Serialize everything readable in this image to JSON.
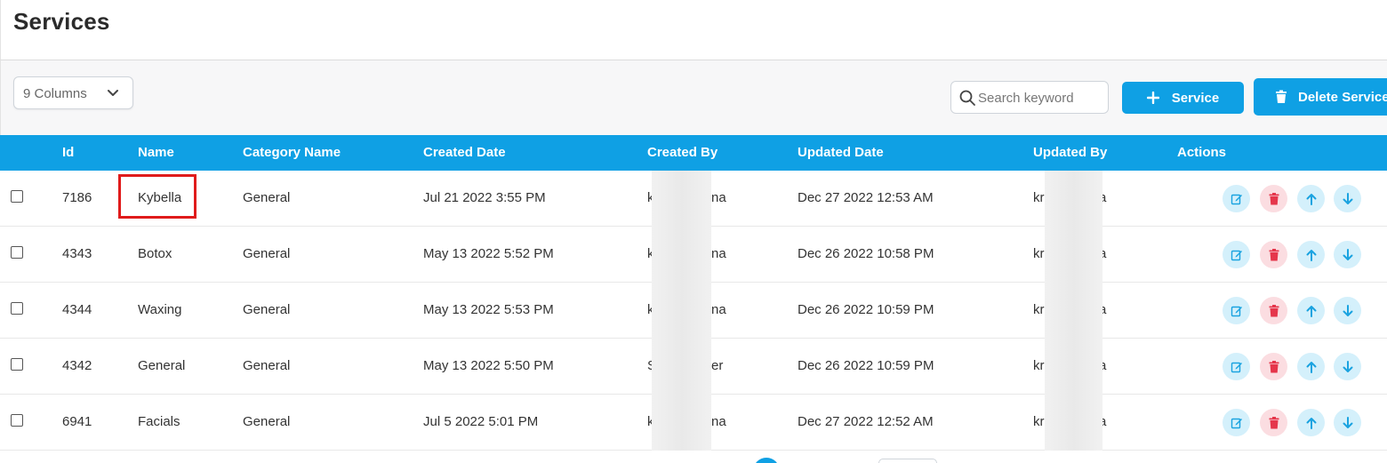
{
  "page": {
    "title": "Services"
  },
  "toolbar": {
    "columns_select": {
      "value": "9 Columns",
      "icon": "chevron-down-icon"
    },
    "search": {
      "placeholder": "Search keyword",
      "value": "",
      "icon": "search-icon"
    },
    "add_button": {
      "label": "Service",
      "icon": "plus-icon"
    },
    "delete_button": {
      "label": "Delete Service",
      "icon": "trash-icon"
    },
    "accent_color": "#0fa0e4"
  },
  "table": {
    "headers": [
      "Id",
      "Name",
      "Category Name",
      "Created Date",
      "Created By",
      "Updated Date",
      "Updated By",
      "Actions"
    ],
    "rows": [
      {
        "id": "7186",
        "name": "Kybella",
        "category": "General",
        "created_date": "Jul 21 2022 3:55 PM",
        "created_by_a": "k",
        "created_by_b": "na",
        "updated_date": "Dec 27 2022 12:53 AM",
        "updated_by_a": "kr",
        "updated_by_b": "a"
      },
      {
        "id": "4343",
        "name": "Botox",
        "category": "General",
        "created_date": "May 13 2022 5:52 PM",
        "created_by_a": "k",
        "created_by_b": "na",
        "updated_date": "Dec 26 2022 10:58 PM",
        "updated_by_a": "kr",
        "updated_by_b": "a"
      },
      {
        "id": "4344",
        "name": "Waxing",
        "category": "General",
        "created_date": "May 13 2022 5:53 PM",
        "created_by_a": "k",
        "created_by_b": "na",
        "updated_date": "Dec 26 2022 10:59 PM",
        "updated_by_a": "kr",
        "updated_by_b": "a"
      },
      {
        "id": "4342",
        "name": "General",
        "category": "General",
        "created_date": "May 13 2022 5:50 PM",
        "created_by_a": "S",
        "created_by_b": "er",
        "updated_date": "Dec 26 2022 10:59 PM",
        "updated_by_a": "kr",
        "updated_by_b": "a"
      },
      {
        "id": "6941",
        "name": "Facials",
        "category": "General",
        "created_date": "Jul 5 2022 5:01 PM",
        "created_by_a": "k",
        "created_by_b": "na",
        "updated_date": "Dec 27 2022 12:52 AM",
        "updated_by_a": "kr",
        "updated_by_b": "a"
      }
    ],
    "row_actions": [
      "edit-icon",
      "trash-icon",
      "arrow-up-icon",
      "arrow-down-icon"
    ],
    "highlighted_cell": "Kybella"
  }
}
